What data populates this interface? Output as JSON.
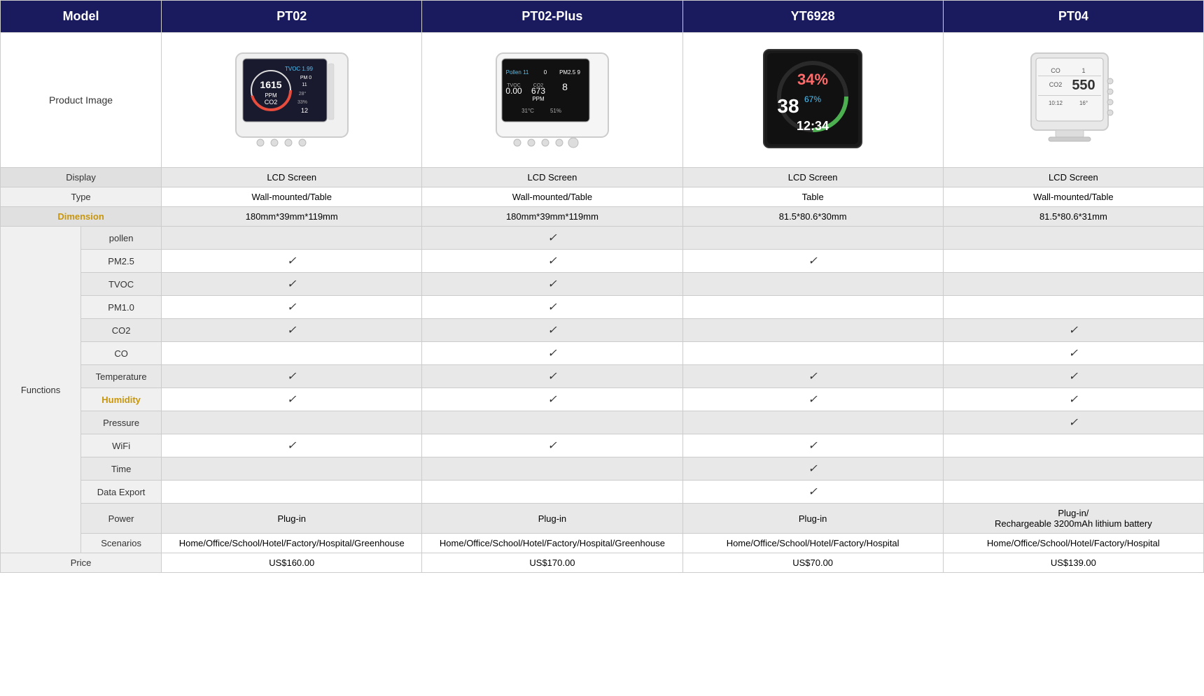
{
  "header": {
    "col_model": "Model",
    "col1": "PT02",
    "col2": "PT02-Plus",
    "col3": "YT6928",
    "col4": "PT04"
  },
  "product_image_label": "Product Image",
  "rows": {
    "display": {
      "label": "Display",
      "v1": "LCD Screen",
      "v2": "LCD Screen",
      "v3": "LCD Screen",
      "v4": "LCD Screen"
    },
    "type": {
      "label": "Type",
      "v1": "Wall-mounted/Table",
      "v2": "Wall-mounted/Table",
      "v3": "Table",
      "v4": "Wall-mounted/Table"
    },
    "dimension": {
      "label": "Dimension",
      "v1": "180mm*39mm*119mm",
      "v2": "180mm*39mm*119mm",
      "v3": "81.5*80.6*30mm",
      "v4": "81.5*80.6*31mm"
    }
  },
  "functions_label": "Functions",
  "function_rows": [
    {
      "label": "pollen",
      "v1": "",
      "v2": "✓",
      "v3": "",
      "v4": "",
      "highlight": false,
      "gray": true
    },
    {
      "label": "PM2.5",
      "v1": "✓",
      "v2": "✓",
      "v3": "✓",
      "v4": "",
      "highlight": false,
      "gray": false
    },
    {
      "label": "TVOC",
      "v1": "✓",
      "v2": "✓",
      "v3": "",
      "v4": "",
      "highlight": false,
      "gray": true
    },
    {
      "label": "PM1.0",
      "v1": "✓",
      "v2": "✓",
      "v3": "",
      "v4": "",
      "highlight": false,
      "gray": false
    },
    {
      "label": "CO2",
      "v1": "✓",
      "v2": "✓",
      "v3": "",
      "v4": "✓",
      "highlight": false,
      "gray": true
    },
    {
      "label": "CO",
      "v1": "",
      "v2": "✓",
      "v3": "",
      "v4": "✓",
      "highlight": false,
      "gray": false
    },
    {
      "label": "Temperature",
      "v1": "✓",
      "v2": "✓",
      "v3": "✓",
      "v4": "✓",
      "highlight": false,
      "gray": true
    },
    {
      "label": "Humidity",
      "v1": "✓",
      "v2": "✓",
      "v3": "✓",
      "v4": "✓",
      "highlight": true,
      "gray": false
    },
    {
      "label": "Pressure",
      "v1": "",
      "v2": "",
      "v3": "",
      "v4": "✓",
      "highlight": false,
      "gray": true
    },
    {
      "label": "WiFi",
      "v1": "✓",
      "v2": "✓",
      "v3": "✓",
      "v4": "",
      "highlight": false,
      "gray": false
    },
    {
      "label": "Time",
      "v1": "",
      "v2": "",
      "v3": "✓",
      "v4": "",
      "highlight": false,
      "gray": true
    },
    {
      "label": "Data Export",
      "v1": "",
      "v2": "",
      "v3": "✓",
      "v4": "",
      "highlight": false,
      "gray": false
    },
    {
      "label": "Power",
      "v1": "Plug-in",
      "v2": "Plug-in",
      "v3": "Plug-in",
      "v4": "Plug-in/\nRechargeable 3200mAh lithium battery",
      "highlight": false,
      "gray": true
    },
    {
      "label": "Scenarios",
      "v1": "Home/Office/School/Hotel/Factory/Hospital/Greenhouse",
      "v2": "Home/Office/School/Hotel/Factory/Hospital/Greenhouse",
      "v3": "Home/Office/School/Hotel/Factory/Hospital",
      "v4": "Home/Office/School/Hotel/Factory/Hospital",
      "highlight": false,
      "gray": false
    }
  ],
  "price": {
    "label": "Price",
    "v1": "US$160.00",
    "v2": "US$170.00",
    "v3": "US$70.00",
    "v4": "US$139.00"
  }
}
